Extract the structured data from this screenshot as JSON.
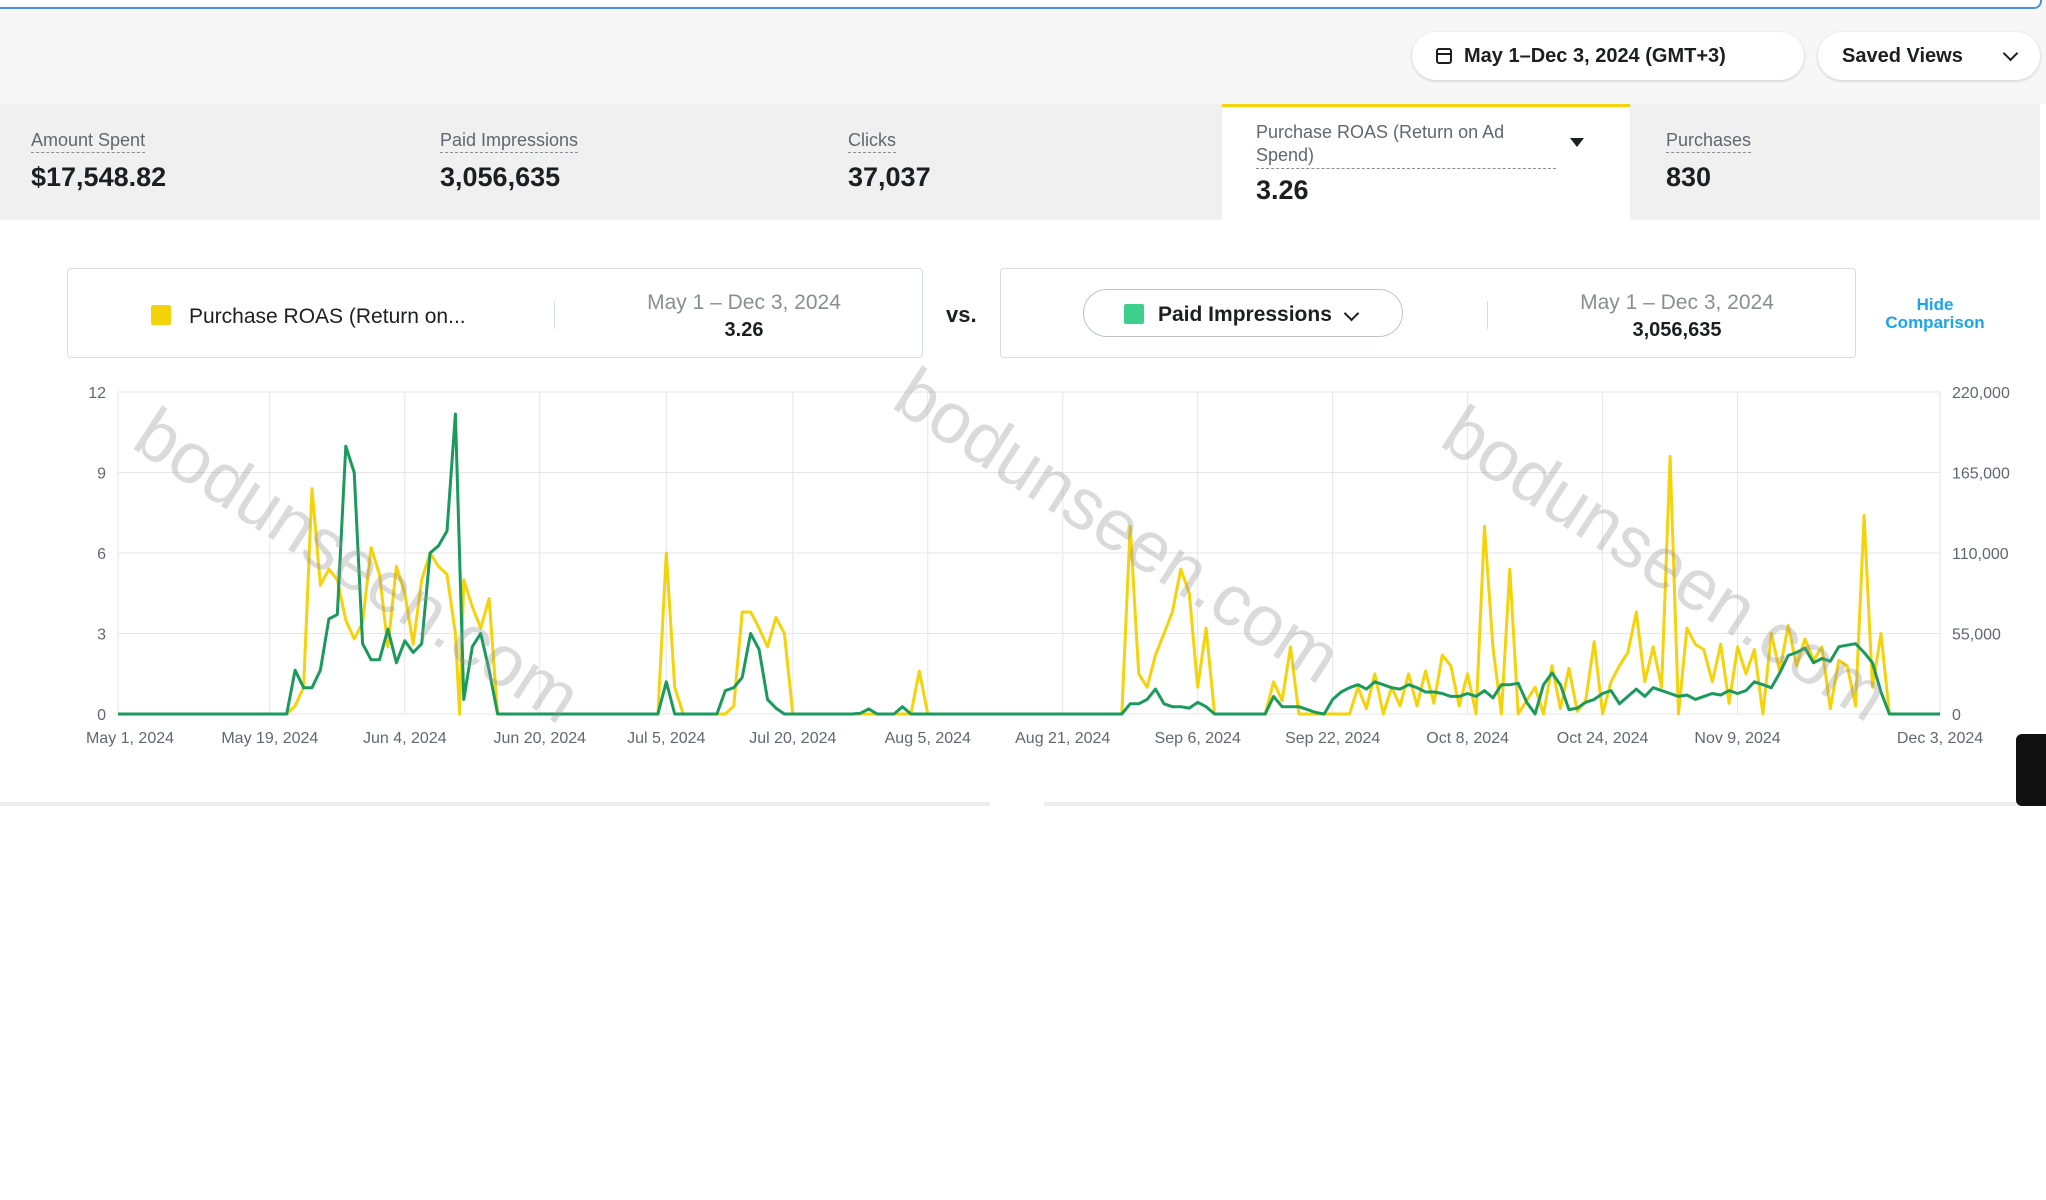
{
  "header": {
    "date_range": "May 1–Dec 3, 2024 (GMT+3)",
    "saved_views": "Saved Views"
  },
  "metrics": [
    {
      "label": "Amount Spent",
      "value": "$17,548.82"
    },
    {
      "label": "Paid Impressions",
      "value": "3,056,635"
    },
    {
      "label": "Clicks",
      "value": "37,037"
    },
    {
      "label": "Purchase ROAS (Return on Ad Spend)",
      "value": "3.26",
      "selected": true
    },
    {
      "label": "Purchases",
      "value": "830"
    }
  ],
  "comparison": {
    "left": {
      "name": "Purchase ROAS (Return on...",
      "date": "May 1 – Dec 3, 2024",
      "value": "3.26",
      "color": "#f5d30b"
    },
    "vs": "vs.",
    "right": {
      "name": "Paid Impressions",
      "date": "May 1 – Dec 3, 2024",
      "value": "3,056,635",
      "color": "#3ecf8e"
    },
    "hide_label_1": "Hide",
    "hide_label_2": "Comparison"
  },
  "watermark": "bodunseen.com",
  "chart_data": {
    "type": "line",
    "x_ticks": [
      "May 1, 2024",
      "May 19, 2024",
      "Jun 4, 2024",
      "Jun 20, 2024",
      "Jul 5, 2024",
      "Jul 20, 2024",
      "Aug 5, 2024",
      "Aug 21, 2024",
      "Sep 6, 2024",
      "Sep 22, 2024",
      "Oct 8, 2024",
      "Oct 24, 2024",
      "Nov 9, 2024",
      "Dec 3, 2024"
    ],
    "x_tick_days": [
      0,
      18,
      34,
      50,
      65,
      80,
      96,
      112,
      128,
      144,
      160,
      176,
      192,
      216
    ],
    "y_left": {
      "ticks": [
        "0",
        "3",
        "6",
        "9",
        "12"
      ],
      "range": [
        0,
        12
      ]
    },
    "y_right": {
      "ticks": [
        "0",
        "55,000",
        "110,000",
        "165,000",
        "220,000"
      ],
      "range": [
        0,
        220000
      ]
    },
    "grid": true,
    "series": [
      {
        "name": "Purchase ROAS (Return on Ad Spend)",
        "axis": "left",
        "color": "#f5d30b",
        "points": [
          [
            0,
            0
          ],
          [
            20,
            0
          ],
          [
            21,
            0.3
          ],
          [
            22,
            1
          ],
          [
            23,
            8.4
          ],
          [
            24,
            4.8
          ],
          [
            25,
            5.4
          ],
          [
            26,
            5
          ],
          [
            27,
            3.5
          ],
          [
            28,
            2.8
          ],
          [
            29,
            3.4
          ],
          [
            30,
            6.2
          ],
          [
            31,
            5.2
          ],
          [
            32,
            2.5
          ],
          [
            33,
            5.5
          ],
          [
            34,
            4.5
          ],
          [
            35,
            2.6
          ],
          [
            36,
            5
          ],
          [
            37,
            6
          ],
          [
            38,
            5.5
          ],
          [
            39,
            5.2
          ],
          [
            40,
            3
          ],
          [
            40.5,
            0
          ],
          [
            41,
            5
          ],
          [
            42,
            4
          ],
          [
            43,
            3.2
          ],
          [
            44,
            4.3
          ],
          [
            45,
            0
          ],
          [
            64,
            0
          ],
          [
            65,
            6
          ],
          [
            66,
            1
          ],
          [
            67,
            0
          ],
          [
            72,
            0
          ],
          [
            73,
            0.3
          ],
          [
            74,
            3.8
          ],
          [
            75,
            3.8
          ],
          [
            76,
            3.2
          ],
          [
            77,
            2.5
          ],
          [
            78,
            3.6
          ],
          [
            79,
            3
          ],
          [
            80,
            0
          ],
          [
            94,
            0
          ],
          [
            95,
            1.6
          ],
          [
            96,
            0
          ],
          [
            119,
            0
          ],
          [
            120,
            7
          ],
          [
            121,
            1.5
          ],
          [
            122,
            1
          ],
          [
            123,
            2.2
          ],
          [
            124,
            3
          ],
          [
            125,
            3.8
          ],
          [
            126,
            5.4
          ],
          [
            127,
            4.5
          ],
          [
            128,
            1
          ],
          [
            129,
            3.2
          ],
          [
            130,
            0
          ],
          [
            136,
            0
          ],
          [
            137,
            1.2
          ],
          [
            138,
            0.5
          ],
          [
            139,
            2.5
          ],
          [
            140,
            0
          ],
          [
            146,
            0
          ],
          [
            147,
            1
          ],
          [
            148,
            0.2
          ],
          [
            149,
            1.5
          ],
          [
            150,
            0
          ],
          [
            151,
            1
          ],
          [
            152,
            0.3
          ],
          [
            153,
            1.5
          ],
          [
            154,
            0.3
          ],
          [
            155,
            1.6
          ],
          [
            156,
            0.4
          ],
          [
            157,
            2.2
          ],
          [
            158,
            1.8
          ],
          [
            159,
            0.3
          ],
          [
            160,
            1.5
          ],
          [
            161,
            0
          ],
          [
            162,
            7
          ],
          [
            163,
            2.5
          ],
          [
            164,
            0
          ],
          [
            165,
            5.4
          ],
          [
            166,
            0
          ],
          [
            167,
            0.5
          ],
          [
            168,
            1
          ],
          [
            169,
            0
          ],
          [
            170,
            1.8
          ],
          [
            171,
            0.2
          ],
          [
            172,
            1.7
          ],
          [
            173,
            0.1
          ],
          [
            174,
            0.5
          ],
          [
            175,
            2.7
          ],
          [
            176,
            0
          ],
          [
            177,
            1.2
          ],
          [
            178,
            1.8
          ],
          [
            179,
            2.3
          ],
          [
            180,
            3.8
          ],
          [
            181,
            1.2
          ],
          [
            182,
            2.5
          ],
          [
            183,
            1
          ],
          [
            184,
            9.6
          ],
          [
            185,
            0
          ],
          [
            186,
            3.2
          ],
          [
            187,
            2.6
          ],
          [
            188,
            2.4
          ],
          [
            189,
            1.2
          ],
          [
            190,
            2.6
          ],
          [
            191,
            0.4
          ],
          [
            192,
            2.5
          ],
          [
            193,
            1.5
          ],
          [
            194,
            2.4
          ],
          [
            195,
            0
          ],
          [
            196,
            3
          ],
          [
            197,
            1.6
          ],
          [
            198,
            3.3
          ],
          [
            199,
            1.8
          ],
          [
            200,
            2.8
          ],
          [
            201,
            2
          ],
          [
            202,
            2.5
          ],
          [
            203,
            0.2
          ],
          [
            204,
            2
          ],
          [
            205,
            1.8
          ],
          [
            206,
            0.3
          ],
          [
            207,
            7.4
          ],
          [
            208,
            1
          ],
          [
            209,
            3
          ],
          [
            210,
            0
          ],
          [
            216,
            0
          ]
        ]
      },
      {
        "name": "Paid Impressions",
        "axis": "right",
        "color": "#1a9a5c",
        "points": [
          [
            0,
            0
          ],
          [
            20,
            0
          ],
          [
            21,
            30000
          ],
          [
            22,
            18000
          ],
          [
            23,
            18000
          ],
          [
            24,
            30000
          ],
          [
            25,
            65000
          ],
          [
            26,
            68000
          ],
          [
            27,
            183000
          ],
          [
            28,
            165000
          ],
          [
            29,
            48000
          ],
          [
            30,
            37000
          ],
          [
            31,
            37000
          ],
          [
            32,
            58000
          ],
          [
            33,
            35000
          ],
          [
            34,
            50000
          ],
          [
            35,
            42000
          ],
          [
            36,
            48000
          ],
          [
            37,
            110000
          ],
          [
            38,
            115000
          ],
          [
            39,
            125000
          ],
          [
            40,
            205000
          ],
          [
            41,
            10000
          ],
          [
            42,
            46000
          ],
          [
            43,
            55000
          ],
          [
            44,
            30000
          ],
          [
            45,
            0
          ],
          [
            64,
            0
          ],
          [
            65,
            22000
          ],
          [
            66,
            0
          ],
          [
            71,
            0
          ],
          [
            72,
            16000
          ],
          [
            73,
            18000
          ],
          [
            74,
            25000
          ],
          [
            75,
            55000
          ],
          [
            76,
            44000
          ],
          [
            77,
            10000
          ],
          [
            78,
            4000
          ],
          [
            79,
            0
          ],
          [
            87,
            0
          ],
          [
            88,
            500
          ],
          [
            89,
            3500
          ],
          [
            90,
            0
          ],
          [
            92,
            0
          ],
          [
            93,
            5000
          ],
          [
            94,
            0
          ],
          [
            119,
            0
          ],
          [
            120,
            7000
          ],
          [
            121,
            7000
          ],
          [
            122,
            10000
          ],
          [
            123,
            17000
          ],
          [
            124,
            7000
          ],
          [
            125,
            5000
          ],
          [
            126,
            5000
          ],
          [
            127,
            4000
          ],
          [
            128,
            8000
          ],
          [
            129,
            5000
          ],
          [
            130,
            0
          ],
          [
            136,
            0
          ],
          [
            137,
            12000
          ],
          [
            138,
            5000
          ],
          [
            139,
            5000
          ],
          [
            140,
            5000
          ],
          [
            141,
            3000
          ],
          [
            142,
            1000
          ],
          [
            143,
            0
          ],
          [
            144,
            10000
          ],
          [
            145,
            15000
          ],
          [
            146,
            18000
          ],
          [
            147,
            20000
          ],
          [
            148,
            17000
          ],
          [
            149,
            22000
          ],
          [
            150,
            20000
          ],
          [
            151,
            18000
          ],
          [
            152,
            17000
          ],
          [
            153,
            20000
          ],
          [
            154,
            18000
          ],
          [
            155,
            15000
          ],
          [
            156,
            15000
          ],
          [
            157,
            14000
          ],
          [
            158,
            12000
          ],
          [
            159,
            12000
          ],
          [
            160,
            14000
          ],
          [
            161,
            12000
          ],
          [
            162,
            16000
          ],
          [
            163,
            11000
          ],
          [
            164,
            20000
          ],
          [
            165,
            20000
          ],
          [
            166,
            21000
          ],
          [
            167,
            8000
          ],
          [
            168,
            0
          ],
          [
            169,
            20000
          ],
          [
            170,
            28000
          ],
          [
            171,
            20000
          ],
          [
            172,
            3000
          ],
          [
            173,
            4000
          ],
          [
            174,
            8000
          ],
          [
            175,
            10000
          ],
          [
            176,
            14000
          ],
          [
            177,
            16000
          ],
          [
            178,
            7000
          ],
          [
            179,
            12000
          ],
          [
            180,
            17000
          ],
          [
            181,
            12000
          ],
          [
            182,
            18000
          ],
          [
            183,
            16000
          ],
          [
            184,
            14000
          ],
          [
            185,
            12000
          ],
          [
            186,
            13000
          ],
          [
            187,
            10000
          ],
          [
            188,
            12000
          ],
          [
            189,
            14000
          ],
          [
            190,
            13000
          ],
          [
            191,
            16000
          ],
          [
            192,
            14000
          ],
          [
            193,
            16000
          ],
          [
            194,
            22000
          ],
          [
            195,
            20000
          ],
          [
            196,
            18000
          ],
          [
            197,
            28000
          ],
          [
            198,
            40000
          ],
          [
            199,
            42000
          ],
          [
            200,
            45000
          ],
          [
            201,
            35000
          ],
          [
            202,
            38000
          ],
          [
            203,
            36000
          ],
          [
            204,
            46000
          ],
          [
            205,
            47000
          ],
          [
            206,
            48000
          ],
          [
            207,
            42000
          ],
          [
            208,
            35000
          ],
          [
            209,
            15000
          ],
          [
            210,
            0
          ],
          [
            216,
            0
          ]
        ]
      }
    ]
  }
}
